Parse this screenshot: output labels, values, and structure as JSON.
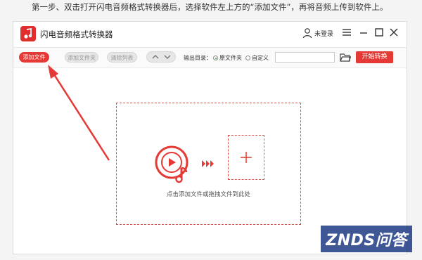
{
  "instruction": "第一步、双击打开闪电音频格式转换器后，选择软件左上方的“添加文件”，再将音频上传到软件上。",
  "app": {
    "title": "闪电音频格式转换器",
    "user_label": "未登录",
    "logo_icon": "music-note-icon"
  },
  "toolbar": {
    "add_file": "添加文件",
    "add_folder": "添加文件夹",
    "clear_list": "清除列表",
    "output_label": "输出目录：",
    "radio_original": "原文件夹",
    "radio_custom": "自定义",
    "output_path_value": "",
    "start": "开始转换"
  },
  "drop_zone": {
    "hint": "点击添加文件或拖拽文件到此处"
  },
  "watermark": "ZNDS问答",
  "colors": {
    "accent": "#e53935",
    "watermark_bg": "#0a2878"
  }
}
